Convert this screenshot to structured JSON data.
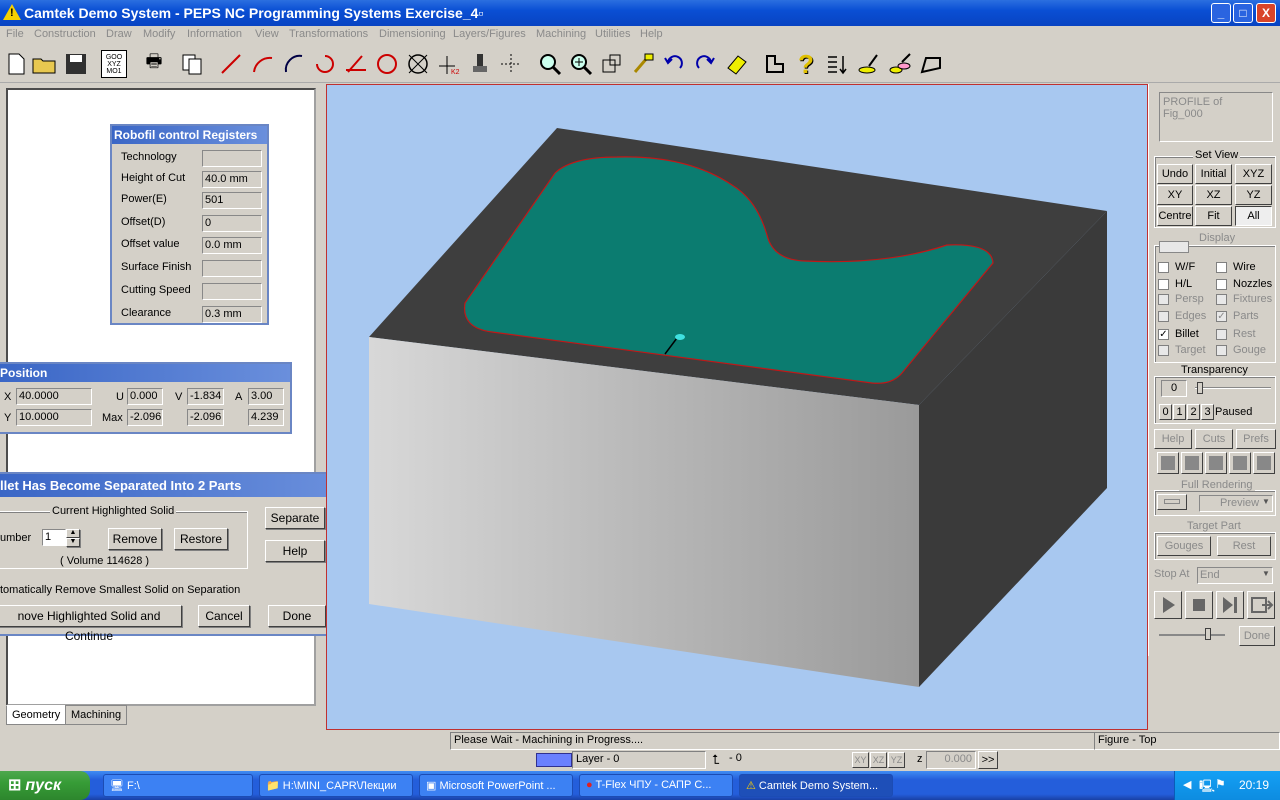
{
  "window": {
    "title": "Camtek Demo System - PEPS NC Programming Systems Exercise_4▫",
    "minimize": "_",
    "maximize": "□",
    "close": "X"
  },
  "menu": [
    "File",
    "Construction",
    "Draw",
    "Modify",
    "Information",
    "View",
    "Transformations",
    "Dimensioning",
    "Layers/Figures",
    "Machining",
    "Utilities",
    "Help"
  ],
  "toolbar": {
    "icons": [
      "new-icon",
      "open-icon",
      "save-icon",
      "goo-xyz-icon",
      "print-icon",
      "copy-icon",
      "line-icon",
      "arc-icon",
      "tangent-arc-icon",
      "circle-point-icon",
      "angle-icon",
      "circle-icon",
      "cross-circle-icon",
      "point-k2-icon",
      "tool-icon",
      "grid-icon",
      "zoom-icon",
      "zoom-plus-icon",
      "zoom-window-icon",
      "paint-icon",
      "undo-icon",
      "redo-icon",
      "eraser-icon",
      "profile-icon",
      "help-question-icon",
      "list-sort-icon",
      "machine-icon-1",
      "machine-icon-2",
      "shape-icon"
    ],
    "goo_label": "GOO\nXYZ\nMO1"
  },
  "registers": {
    "title": "Robofil control Registers",
    "rows": [
      {
        "label": "Technology",
        "value": ""
      },
      {
        "label": "Height of Cut",
        "value": "40.0 mm"
      },
      {
        "label": "Power(E)",
        "value": "501"
      },
      {
        "label": "Offset(D)",
        "value": "0"
      },
      {
        "label": "Offset value",
        "value": "0.0 mm"
      },
      {
        "label": "Surface Finish",
        "value": ""
      },
      {
        "label": "Cutting Speed",
        "value": ""
      },
      {
        "label": "Clearance",
        "value": "0.3 mm"
      }
    ]
  },
  "position": {
    "title": "Position",
    "x_label": "X",
    "x": "40.0000",
    "y_label": "Y",
    "y": "10.0000",
    "u_label": "U",
    "u": "0.000",
    "v_label": "V",
    "v": "-1.834",
    "a_label": "A",
    "a": "3.00",
    "max_label": "Max",
    "max_u": "-2.096",
    "max_v": "-2.096",
    "max_a": "4.239"
  },
  "billet": {
    "title": "llet Has Become Separated Into 2 Parts",
    "group_title": "Current Highlighted Solid",
    "number_label": "umber",
    "number": "1",
    "remove": "Remove",
    "restore": "Restore",
    "volume": "( Volume     114628 )",
    "auto_remove": "tomatically Remove Smallest Solid on Separation",
    "remove_continue": "nove Highlighted Solid and Continue",
    "cancel": "Cancel",
    "done": "Done",
    "separate": "Separate",
    "help": "Help"
  },
  "left_tabs": [
    "Geometry",
    "Machining"
  ],
  "right": {
    "profile": "PROFILE of\nFig_000",
    "set_view": "Set View",
    "view_buttons": [
      "Undo",
      "Initial",
      "XYZ",
      "XY",
      "XZ",
      "YZ",
      "Centre",
      "Fit",
      "All"
    ],
    "display": "Display",
    "checks": [
      {
        "label": "W/F",
        "checked": false,
        "enabled": true
      },
      {
        "label": "Wire",
        "checked": false,
        "enabled": true
      },
      {
        "label": "H/L",
        "checked": false,
        "enabled": true
      },
      {
        "label": "Nozzles",
        "checked": false,
        "enabled": true
      },
      {
        "label": "Persp",
        "checked": false,
        "enabled": false
      },
      {
        "label": "Fixtures",
        "checked": false,
        "enabled": false
      },
      {
        "label": "Edges",
        "checked": false,
        "enabled": false
      },
      {
        "label": "Parts",
        "checked": true,
        "enabled": false
      },
      {
        "label": "Billet",
        "checked": true,
        "enabled": true
      },
      {
        "label": "Rest",
        "checked": false,
        "enabled": false
      },
      {
        "label": "Target",
        "checked": false,
        "enabled": false
      },
      {
        "label": "Gouge",
        "checked": false,
        "enabled": false
      }
    ],
    "transparency": "Transparency",
    "transparency_value": "0",
    "levels": [
      "0",
      "1",
      "2",
      "3"
    ],
    "paused": "Paused",
    "help": "Help",
    "cuts": "Cuts",
    "prefs": "Prefs",
    "full_rendering": "Full Rendering",
    "preview": "Preview",
    "target_part": "Target Part",
    "gouges": "Gouges",
    "rest": "Rest",
    "stop_at": "Stop At",
    "end": "End",
    "done": "Done"
  },
  "status": {
    "message": "Please Wait - Machining in Progress....",
    "view": "Figure - Top",
    "layer": "Layer - 0",
    "snap": "- 0",
    "axes": [
      "XY",
      "XZ",
      "YZ"
    ],
    "z_label": "z",
    "z_value": "0.000",
    "more": ">>"
  },
  "taskbar": {
    "start": "пуск",
    "tasks": [
      "F:\\",
      "H:\\MINI_CAPR\\Лекции",
      "Microsoft PowerPoint ...",
      "T-Flex ЧПУ - САПР С...",
      "Camtek Demo System..."
    ],
    "clock": "20:19"
  },
  "colors": {
    "title_bar": "#0a4fd4",
    "viewport_bg": "#a8c8f0",
    "part_green": "#0b7c70",
    "block_dark": "#3f3f3f"
  }
}
